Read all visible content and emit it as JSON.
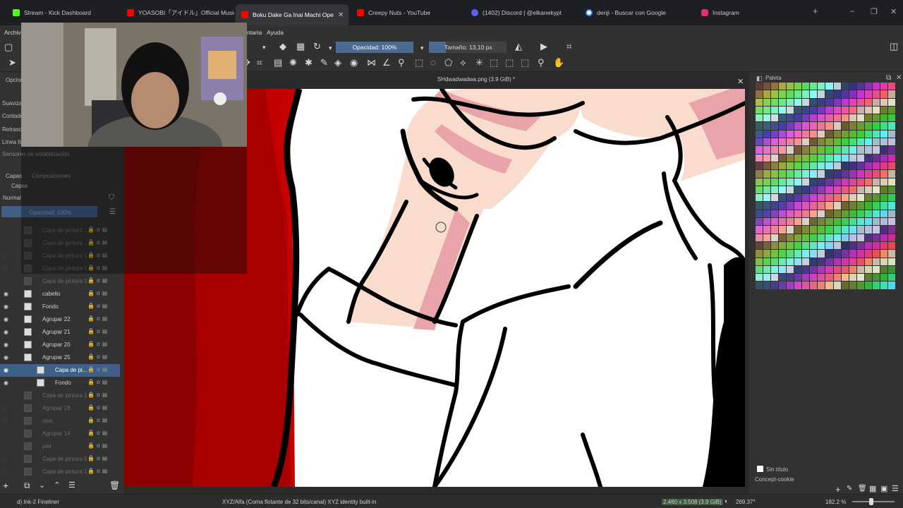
{
  "browser": {
    "tabs": [
      {
        "title": "Stream - Kick Dashboard",
        "color": "#53fc18"
      },
      {
        "title": "YOASOBI「アイドル」Official Music Vid",
        "color": "#ff0000"
      },
      {
        "title": "Boku Dake Ga Inai Machi Ope",
        "color": "#ff0000",
        "active": true
      },
      {
        "title": "Creepy Nuts - YouTube",
        "color": "#ff0000"
      },
      {
        "title": "(1402) Discord | @elkanekypt",
        "color": "#5865f2"
      },
      {
        "title": "denji - Buscar con Google",
        "color": "#4285f4"
      },
      {
        "title": "Instagram",
        "color": "#e1306c"
      }
    ],
    "new_tab": "+",
    "close_glyph": "✕"
  },
  "menubar": {
    "items": [
      "Archivo",
      "ntaria",
      "Ayuda"
    ]
  },
  "toolbar": {
    "opacity_label": "Opacidad: 100%",
    "size_label": "Tamaño: 13,10 px"
  },
  "tool_options": {
    "header": "Opciones",
    "rows": [
      "Suavizado",
      "Contador",
      "Retraso",
      "Línea firme",
      "Sensores de estabilización"
    ]
  },
  "layers": {
    "tabs": [
      "Capas",
      "Composiciones"
    ],
    "panel_title": "Capas",
    "blend_mode": "Normal",
    "opacity": "Opacidad: 100%",
    "rows": [
      {
        "name": "Capa de pintura ...",
        "faded": true
      },
      {
        "name": "Capa de pintura ...",
        "faded": true
      },
      {
        "name": "Capa de pintura 1",
        "faded": true
      },
      {
        "name": "Capa de pintura 1",
        "faded": true
      },
      {
        "name": "Capa de pintura 1",
        "faded": true
      },
      {
        "name": "cabello",
        "faded": false
      },
      {
        "name": "Fondo",
        "faded": false
      },
      {
        "name": "Agrupar 22",
        "faded": false
      },
      {
        "name": "Agrupar 21",
        "faded": false
      },
      {
        "name": "Agrupar 20",
        "faded": false
      },
      {
        "name": "Agrupar 25",
        "faded": false
      },
      {
        "name": "Capa de pi...",
        "faded": false,
        "selected": true
      },
      {
        "name": "Fondo",
        "faded": false
      },
      {
        "name": "Capa de pintura 1",
        "faded": true
      },
      {
        "name": "Agrupar 18",
        "faded": true
      },
      {
        "name": "ojos",
        "faded": true
      },
      {
        "name": "Agrupar 14",
        "faded": true
      },
      {
        "name": "piel",
        "faded": true
      },
      {
        "name": "Capa de pintura 5",
        "faded": true
      },
      {
        "name": "Capa de pintura 1",
        "faded": true
      }
    ]
  },
  "document": {
    "title": "SHdwadwadwa.png (3.9 GiB) *"
  },
  "palette": {
    "title": "Paleta",
    "swatch_name": "Sin título",
    "palette_name": "Concept-cookie"
  },
  "status": {
    "brush": "d) Ink-2 Fineliner",
    "color_space": "XYZ/Alfa (Coma flotante de 32 bits/canal)  XYZ identity built-in",
    "dimensions": "2.480 x 3.508 (3.9 GiB)",
    "rotation": "269.37°",
    "zoom": "182.2 %"
  },
  "colors": {
    "accent": "#4a6a8f",
    "skin": "#f9dccd",
    "skin_shadow": "#e8a4a8",
    "red_bg": "#c40000"
  }
}
